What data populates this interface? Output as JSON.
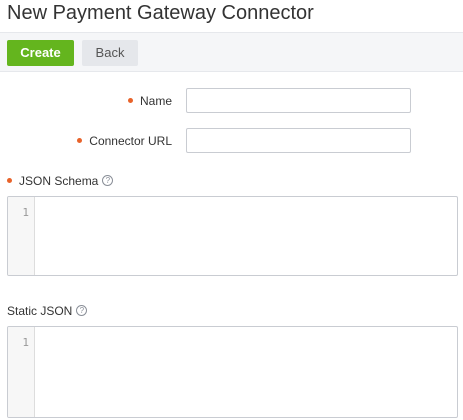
{
  "page": {
    "title": "New Payment Gateway Connector"
  },
  "toolbar": {
    "create_label": "Create",
    "back_label": "Back"
  },
  "form": {
    "name": {
      "label": "Name",
      "value": "",
      "required": true
    },
    "connector_url": {
      "label": "Connector URL",
      "value": "",
      "required": true
    },
    "json_schema": {
      "label": "JSON Schema",
      "required": true,
      "help_icon": "question-circle-icon",
      "line_number": "1",
      "value": ""
    },
    "static_json": {
      "label": "Static JSON",
      "required": false,
      "help_icon": "question-circle-icon",
      "line_number": "1",
      "value": ""
    }
  },
  "colors": {
    "primary_button": "#64b51e",
    "required_marker": "#e8632a"
  }
}
